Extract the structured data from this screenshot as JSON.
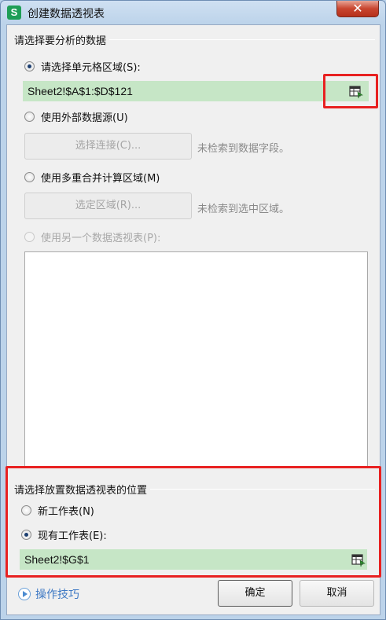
{
  "window": {
    "app_icon_letter": "S",
    "title": "创建数据透视表",
    "close_glyph": "✕"
  },
  "source_group": {
    "title": "请选择要分析的数据",
    "option_cell_range": {
      "label": "请选择单元格区域(S):",
      "checked": true
    },
    "cell_range_value": "Sheet2!$A$1:$D$121",
    "option_external": {
      "label": "使用外部数据源(U)",
      "checked": false
    },
    "select_connection_button": "选择连接(C)...",
    "external_note": "未检索到数据字段。",
    "option_consolidation": {
      "label": "使用多重合并计算区域(M)",
      "checked": false
    },
    "select_range_button": "选定区域(R)...",
    "consolidation_note": "未检索到选中区域。",
    "option_other_pivot": {
      "label": "使用另一个数据透视表(P):",
      "checked": false,
      "disabled": true
    }
  },
  "location_group": {
    "title": "请选择放置数据透视表的位置",
    "option_new_sheet": {
      "label": "新工作表(N)",
      "checked": false
    },
    "option_existing_sheet": {
      "label": "现有工作表(E):",
      "checked": true
    },
    "location_value": "Sheet2!$G$1"
  },
  "footer": {
    "tips_label": "操作技巧",
    "ok_button": "确定",
    "cancel_button": "取消"
  },
  "colors": {
    "range_field_bg": "#c6e6c6",
    "highlight_border": "#e82121",
    "tips_link": "#3e79c4"
  },
  "icons": {
    "range_picker": "range-select-icon",
    "tips": "play-circle-icon"
  }
}
